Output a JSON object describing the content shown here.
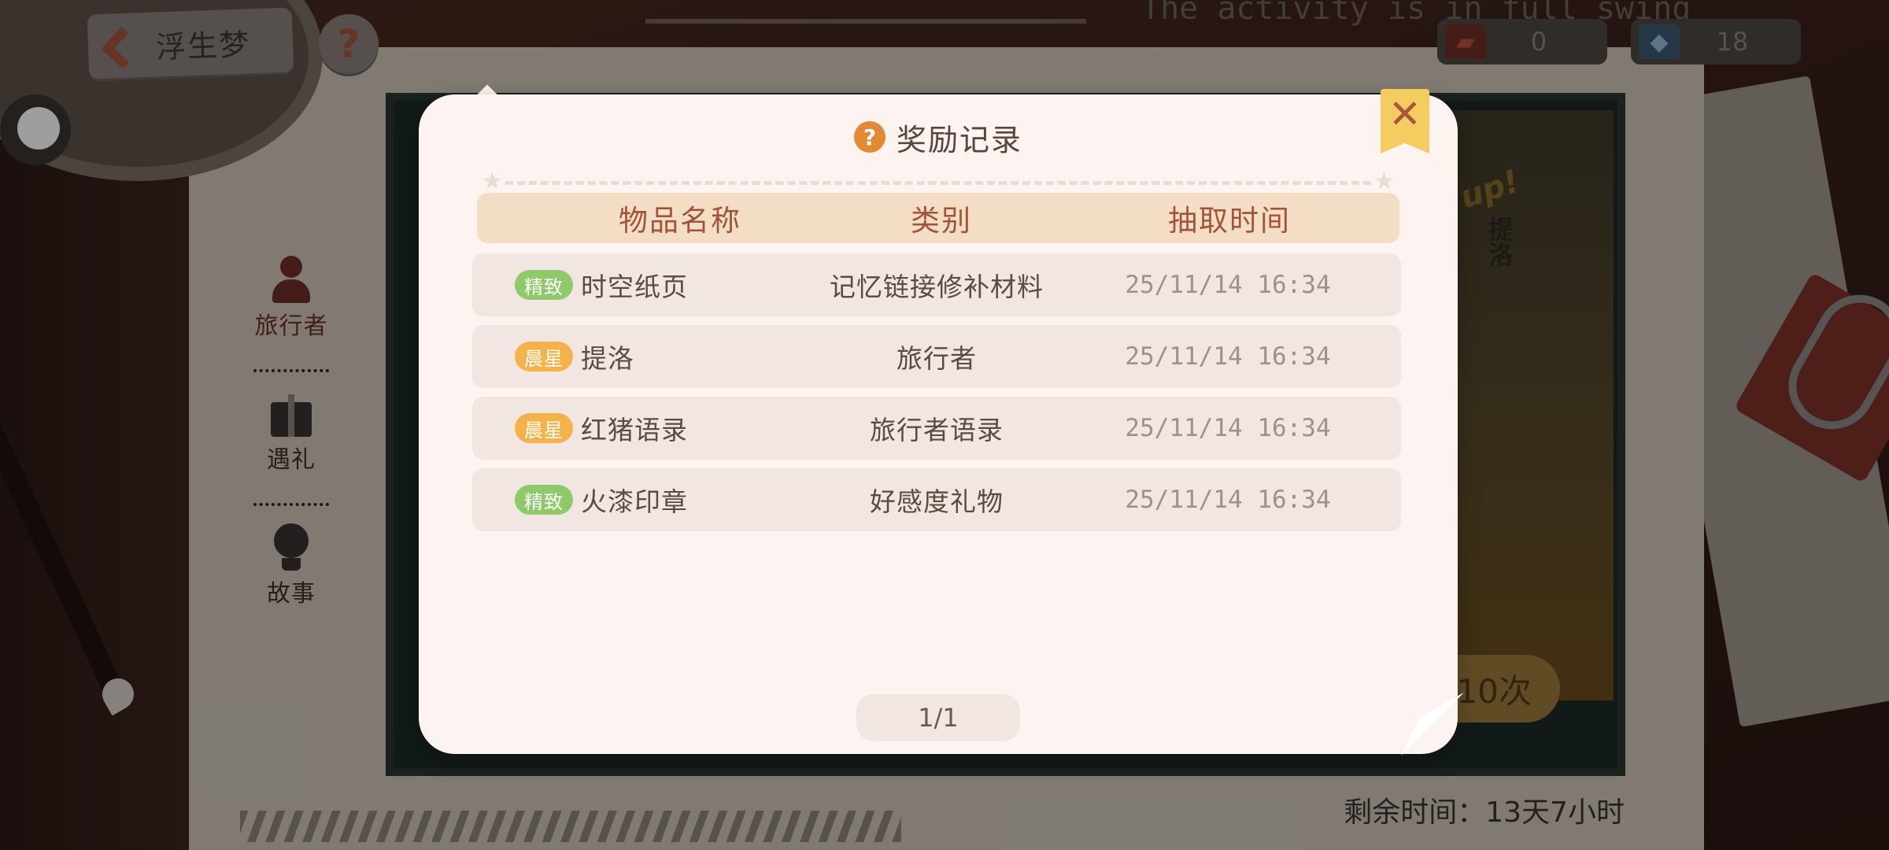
{
  "header": {
    "back_label": "浮生梦",
    "help_glyph": "?",
    "bg_headline": "The activity is in full swing"
  },
  "currencies": [
    {
      "icon": "ticket-icon",
      "value": "0"
    },
    {
      "icon": "gem-add-icon",
      "value": "18"
    }
  ],
  "side_nav": {
    "items": [
      {
        "label": "旅行者",
        "icon": "person-icon"
      },
      {
        "label": "遇礼",
        "icon": "gift-icon"
      },
      {
        "label": "故事",
        "icon": "lightbulb-icon"
      }
    ]
  },
  "background": {
    "up_badge": "up!",
    "art_name": "提洛",
    "draw_ten_label": "10次",
    "remaining_time": "剩余时间：13天7小时"
  },
  "modal": {
    "title": "奖励记录",
    "title_help_glyph": "?",
    "close_glyph": "✕",
    "columns": [
      "物品名称",
      "类别",
      "抽取时间"
    ],
    "rows": [
      {
        "tag": "精致",
        "tag_color": "#8ec96a",
        "name": "时空纸页",
        "category": "记忆链接修补材料",
        "time": "25/11/14 16:34"
      },
      {
        "tag": "晨星",
        "tag_color": "#f4b24a",
        "name": "提洛",
        "category": "旅行者",
        "time": "25/11/14 16:34"
      },
      {
        "tag": "晨星",
        "tag_color": "#f4b24a",
        "name": "红猪语录",
        "category": "旅行者语录",
        "time": "25/11/14 16:34"
      },
      {
        "tag": "精致",
        "tag_color": "#8ec96a",
        "name": "火漆印章",
        "category": "好感度礼物",
        "time": "25/11/14 16:34"
      }
    ],
    "pager": "1/1"
  },
  "colors": {
    "accent_orange": "#e18a33",
    "header_text": "#a1543a",
    "close_yellow": "#f5cc5f",
    "modal_bg": "#fdf3f0"
  }
}
